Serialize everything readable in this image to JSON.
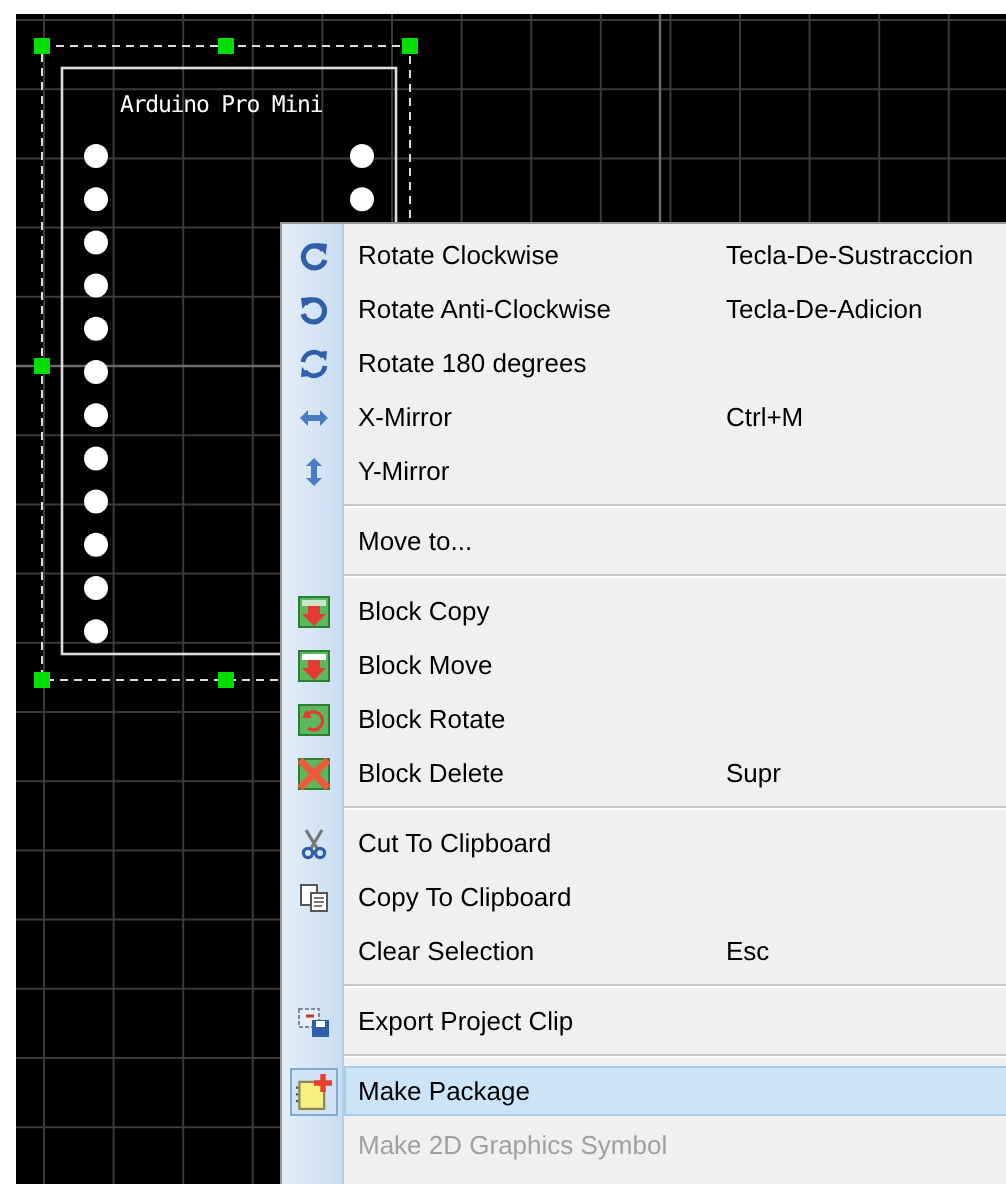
{
  "component": {
    "label": "Arduino Pro Mini"
  },
  "context_menu": {
    "items": [
      {
        "kind": "item",
        "label": "Rotate Clockwise",
        "shortcut": "Tecla-De-Sustraccion",
        "selected": false,
        "disabled": false
      },
      {
        "kind": "item",
        "label": "Rotate Anti-Clockwise",
        "shortcut": "Tecla-De-Adicion",
        "selected": false,
        "disabled": false
      },
      {
        "kind": "item",
        "label": "Rotate 180 degrees",
        "selected": false,
        "disabled": false
      },
      {
        "kind": "item",
        "label": "X-Mirror",
        "shortcut": "Ctrl+M",
        "selected": false,
        "disabled": false
      },
      {
        "kind": "item",
        "label": "Y-Mirror",
        "selected": false,
        "disabled": false
      },
      {
        "kind": "separator"
      },
      {
        "kind": "item",
        "label": "Move to...",
        "selected": false,
        "disabled": false
      },
      {
        "kind": "separator"
      },
      {
        "kind": "item",
        "label": "Block Copy",
        "selected": false,
        "disabled": false
      },
      {
        "kind": "item",
        "label": "Block Move",
        "selected": false,
        "disabled": false
      },
      {
        "kind": "item",
        "label": "Block Rotate",
        "selected": false,
        "disabled": false
      },
      {
        "kind": "item",
        "label": "Block Delete",
        "shortcut": "Supr",
        "selected": false,
        "disabled": false
      },
      {
        "kind": "separator"
      },
      {
        "kind": "item",
        "label": "Cut To Clipboard",
        "selected": false,
        "disabled": false
      },
      {
        "kind": "item",
        "label": "Copy To Clipboard",
        "selected": false,
        "disabled": false
      },
      {
        "kind": "item",
        "label": "Clear Selection",
        "shortcut": "Esc",
        "selected": false,
        "disabled": false
      },
      {
        "kind": "separator"
      },
      {
        "kind": "item",
        "label": "Export Project Clip",
        "selected": false,
        "disabled": false
      },
      {
        "kind": "separator"
      },
      {
        "kind": "item",
        "label": "Make Package",
        "selected": true,
        "disabled": false
      },
      {
        "kind": "item",
        "label": "Make 2D Graphics Symbol",
        "selected": false,
        "disabled": true
      }
    ]
  }
}
